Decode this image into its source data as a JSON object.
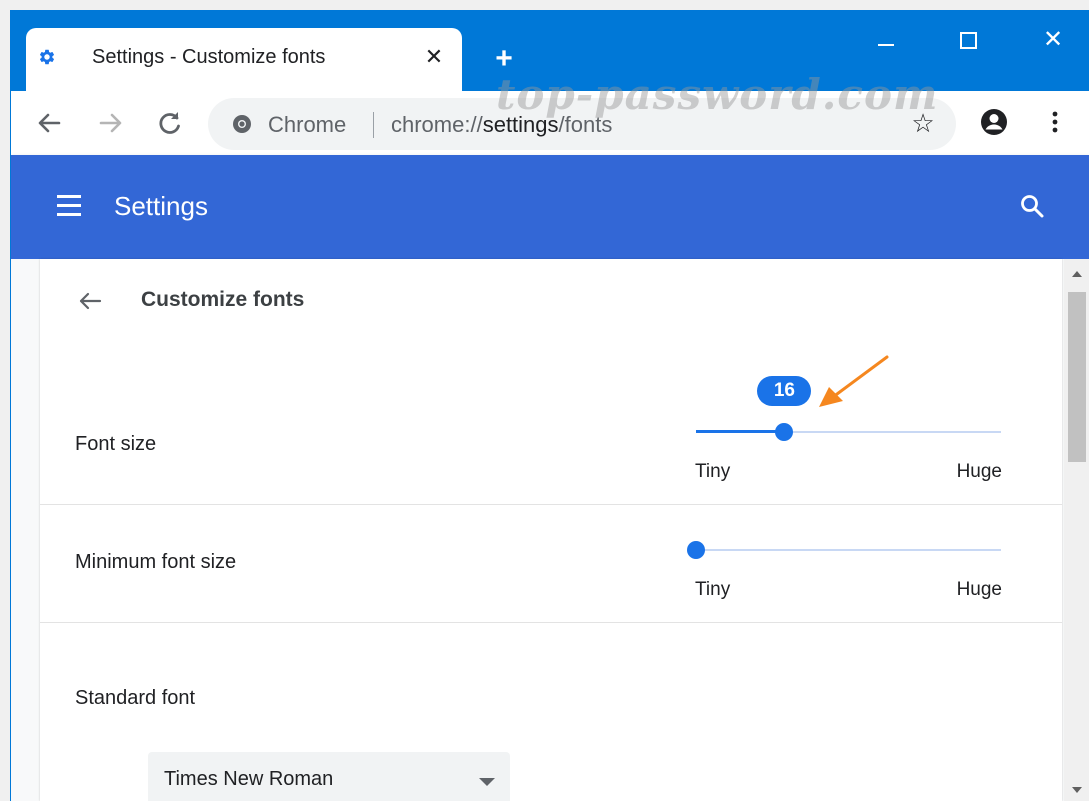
{
  "browser": {
    "tab_title": "Settings - Customize fonts",
    "tab_icon": "gear-icon",
    "new_tab_symbol": "+",
    "close_tab_symbol": "✕",
    "window_close_symbol": "✕",
    "omnibox": {
      "chip": "Chrome",
      "url_prefix": "chrome://",
      "url_host": "settings",
      "url_path": "/fonts"
    },
    "star_symbol": "☆",
    "watermark": "top-password.com"
  },
  "header": {
    "title": "Settings"
  },
  "page": {
    "title": "Customize fonts",
    "font_size": {
      "label": "Font size",
      "value": "16",
      "fraction": 0.29,
      "min_label": "Tiny",
      "max_label": "Huge"
    },
    "minimum_font_size": {
      "label": "Minimum font size",
      "fraction": 0.0,
      "min_label": "Tiny",
      "max_label": "Huge"
    },
    "standard_font": {
      "label": "Standard font",
      "value": "Times New Roman"
    }
  },
  "colors": {
    "titlebar": "#0078d7",
    "settings_header": "#3367d6",
    "accent": "#1a73e8",
    "annotation_arrow": "#f5871f"
  }
}
